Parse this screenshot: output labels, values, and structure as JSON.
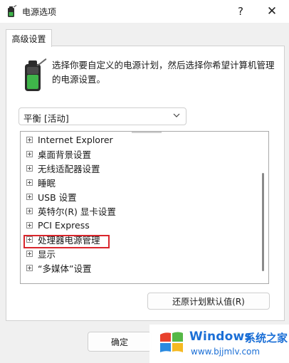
{
  "window": {
    "title": "电源选项",
    "help_glyph": "?",
    "close_glyph": "✕"
  },
  "tabs": [
    {
      "label": "高级设置"
    }
  ],
  "description": "选择你要自定义的电源计划，然后选择你希望计算机管理的电源设置。",
  "plan_dropdown": {
    "selected": "平衡 [活动]"
  },
  "tree_items": [
    {
      "label": "Internet Explorer"
    },
    {
      "label": "桌面背景设置"
    },
    {
      "label": "无线适配器设置"
    },
    {
      "label": "睡眠"
    },
    {
      "label": "USB 设置"
    },
    {
      "label": "英特尔(R) 显卡设置"
    },
    {
      "label": "PCI Express"
    },
    {
      "label": "处理器电源管理"
    },
    {
      "label": "显示"
    },
    {
      "label": "“多媒体”设置"
    }
  ],
  "highlighted_item": "处理器电源管理",
  "buttons": {
    "restore_defaults": "还原计划默认值(R)",
    "ok": "确定"
  },
  "watermark": {
    "title": "Windows",
    "subtitle": "系统之家",
    "url": "www.bjjmlv.com"
  },
  "colors": {
    "highlight_border": "#d9262c",
    "watermark_blue": "#1b6fd6",
    "battery_green": "#3fb54a"
  },
  "icons": {
    "app": "battery-plug-icon",
    "description": "battery-icon",
    "expand": "plus-box-icon",
    "dropdown": "chevron-down-icon",
    "watermark": "windows-logo-icon"
  }
}
